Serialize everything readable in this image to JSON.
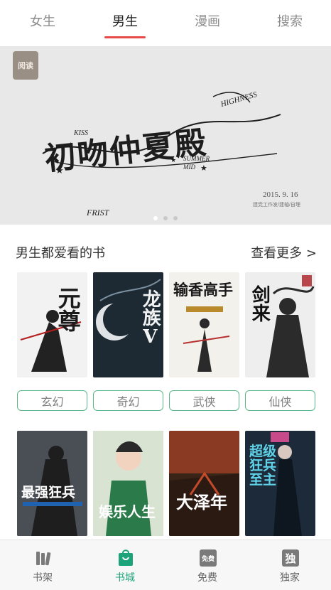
{
  "top_tabs": [
    {
      "label": "女生"
    },
    {
      "label": "男生"
    },
    {
      "label": "漫画"
    },
    {
      "label": "搜索"
    }
  ],
  "top_tabs_active": "男生",
  "banner": {
    "logo_text": "阅读",
    "title": "初吻仲夏殿",
    "words": {
      "kiss": "KISS",
      "first": "FRIST",
      "highness": "HIGHNESS",
      "summer": "SUMMER",
      "mid": "MID"
    },
    "date": "2015. 9. 16",
    "date_sub": "建党工作发/建轴/自理",
    "slides": 3,
    "active_slide": 1
  },
  "section": {
    "title": "男生都爱看的书",
    "more": "查看更多 >"
  },
  "books_row1": [
    {
      "title": "元尊",
      "bg": "#f2f2f2",
      "fg": "#1a1a1a",
      "accent": "#b51c1c"
    },
    {
      "title": "龙族Ⅴ",
      "bg": "#1e2a33",
      "fg": "#f2f2f2",
      "accent": "#7c8f9e"
    },
    {
      "title": "输香高手",
      "bg": "#f3f1ec",
      "fg": "#1a1a1a",
      "accent": "#b88a2b"
    },
    {
      "title": "剑来",
      "bg": "#eeeeee",
      "fg": "#111111",
      "accent": "#b8464a"
    }
  ],
  "tags": [
    {
      "label": "玄幻"
    },
    {
      "label": "奇幻"
    },
    {
      "label": "武侠"
    },
    {
      "label": "仙侠"
    }
  ],
  "books_row2": [
    {
      "title": "最强狂兵",
      "bg": "#3b3f44",
      "fg": "#ffffff",
      "accent": "#1f62b0"
    },
    {
      "title": "娱乐人生",
      "bg": "#2b7a4a",
      "fg": "#ffffff",
      "accent": "#f0c74a"
    },
    {
      "title": "大泽年",
      "bg": "#3a2418",
      "fg": "#ffffff",
      "accent": "#c24a2a"
    },
    {
      "title": "超级狂兵至主",
      "bg": "#1c2a3a",
      "fg": "#5fd2e8",
      "accent": "#c94a8a"
    }
  ],
  "bottom_nav": [
    {
      "label": "书架",
      "icon": "bookshelf-icon"
    },
    {
      "label": "书城",
      "icon": "shopping-bag-icon"
    },
    {
      "label": "免费",
      "icon": "free-badge-icon",
      "badge": "免费"
    },
    {
      "label": "独家",
      "icon": "exclusive-badge-icon",
      "badge": "独"
    }
  ],
  "bottom_nav_active": "书城",
  "colors": {
    "accent_red": "#e84a4a",
    "accent_green": "#1da37a",
    "tag_border": "#5cb88a"
  }
}
